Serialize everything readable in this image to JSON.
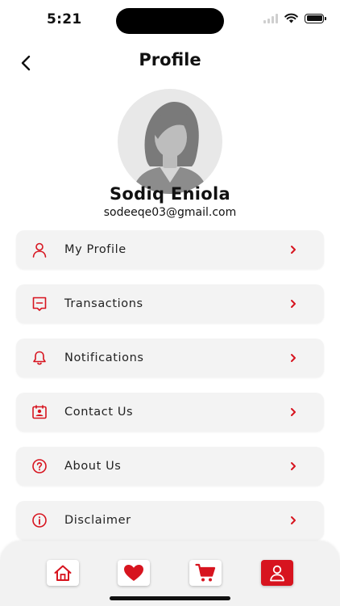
{
  "status_bar": {
    "time": "5:21"
  },
  "header": {
    "title": "Profile"
  },
  "user": {
    "name": "Sodiq Eniola",
    "email": "sodeeqe03@gmail.com"
  },
  "menu": {
    "items": [
      {
        "label": "My Profile",
        "icon": "user-icon"
      },
      {
        "label": "Transactions",
        "icon": "receipt-icon"
      },
      {
        "label": "Notifications",
        "icon": "bell-icon"
      },
      {
        "label": "Contact Us",
        "icon": "contact-card-icon"
      },
      {
        "label": "About Us",
        "icon": "question-circle-icon"
      },
      {
        "label": "Disclaimer",
        "icon": "info-circle-icon"
      }
    ]
  },
  "bottom_nav": {
    "items": [
      {
        "name": "home",
        "icon": "home-icon",
        "active": false
      },
      {
        "name": "favorites",
        "icon": "heart-icon",
        "active": false
      },
      {
        "name": "cart",
        "icon": "cart-icon",
        "active": false
      },
      {
        "name": "profile",
        "icon": "user-icon",
        "active": true
      }
    ]
  },
  "colors": {
    "accent": "#d7141f",
    "card": "#f3f3f3",
    "text": "#111111"
  }
}
